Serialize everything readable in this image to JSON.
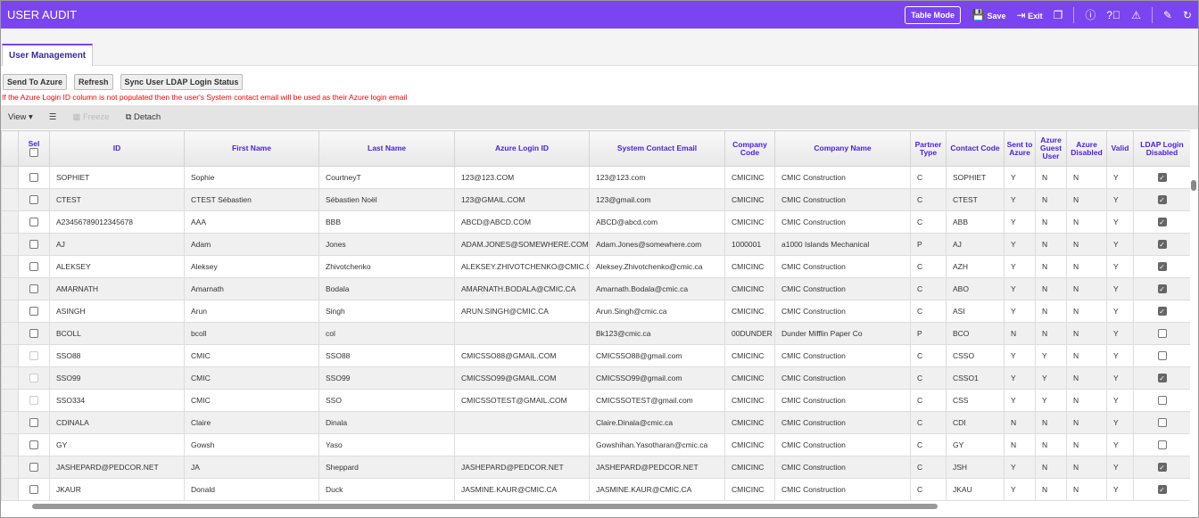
{
  "header": {
    "title": "USER AUDIT",
    "table_mode": "Table Mode",
    "save": "Save",
    "exit": "Exit",
    "icons": [
      "save-icon",
      "exit-icon",
      "windows-icon",
      "info-icon",
      "help-icon",
      "warning-icon",
      "edit-icon",
      "refresh-icon"
    ]
  },
  "tabs": [
    {
      "label": "User Management",
      "active": true
    }
  ],
  "buttons": {
    "send": "Send To Azure",
    "refresh": "Refresh",
    "sync": "Sync User LDAP Login Status"
  },
  "note": "If the Azure Login ID column is not populated then the user's System contact email will be used as their Azure login email",
  "toolbar": {
    "view": "View ▾",
    "freeze": "Freeze",
    "detach": "Detach"
  },
  "colors": {
    "accent": "#7a45f0",
    "header_text": "#4d1fd6",
    "note": "#ff0000"
  },
  "columns": [
    "Sel",
    "ID",
    "First Name",
    "Last Name",
    "Azure Login ID",
    "System Contact Email",
    "Company Code",
    "Company Name",
    "Partner Type",
    "Contact Code",
    "Sent to Azure",
    "Azure Guest User",
    "Azure Disabled",
    "Valid",
    "LDAP Login Disabled"
  ],
  "rows": [
    {
      "id": "SOPHIET",
      "first": "Sophie",
      "last": "CourtneyT",
      "azure": "123@123.COM",
      "email": "123@123.com",
      "code": "CMICINC",
      "company": "CMIC Construction",
      "ptype": "C",
      "contact": "SOPHIET",
      "sent": "Y",
      "guest": "N",
      "disabled": "N",
      "valid": "Y",
      "ldap": true,
      "sel_enabled": true
    },
    {
      "id": "CTEST",
      "first": "CTEST Sébastien",
      "last": "Sébastien Noël",
      "azure": "123@GMAIL.COM",
      "email": "123@gmail.com",
      "code": "CMICINC",
      "company": "CMIC Construction",
      "ptype": "C",
      "contact": "CTEST",
      "sent": "Y",
      "guest": "N",
      "disabled": "N",
      "valid": "Y",
      "ldap": true,
      "sel_enabled": true
    },
    {
      "id": "A23456789012345678",
      "first": "AAA",
      "last": "BBB",
      "azure": "ABCD@ABCD.COM",
      "email": "ABCD@abcd.com",
      "code": "CMICINC",
      "company": "CMIC Construction",
      "ptype": "C",
      "contact": "ABB",
      "sent": "Y",
      "guest": "N",
      "disabled": "N",
      "valid": "Y",
      "ldap": true,
      "sel_enabled": true
    },
    {
      "id": "AJ",
      "first": "Adam",
      "last": "Jones",
      "azure": "ADAM.JONES@SOMEWHERE.COM",
      "email": "Adam.Jones@somewhere.com",
      "code": "1000001",
      "company": "a1000 Islands Mechanical",
      "ptype": "P",
      "contact": "AJ",
      "sent": "Y",
      "guest": "N",
      "disabled": "N",
      "valid": "Y",
      "ldap": true,
      "sel_enabled": true
    },
    {
      "id": "ALEKSEY",
      "first": "Aleksey",
      "last": "Zhivotchenko",
      "azure": "ALEKSEY.ZHIVOTCHENKO@CMIC.CA",
      "email": "Aleksey.Zhivotchenko@cmic.ca",
      "code": "CMICINC",
      "company": "CMIC Construction",
      "ptype": "C",
      "contact": "AZH",
      "sent": "Y",
      "guest": "N",
      "disabled": "N",
      "valid": "Y",
      "ldap": true,
      "sel_enabled": true
    },
    {
      "id": "AMARNATH",
      "first": "Amarnath",
      "last": "Bodala",
      "azure": "AMARNATH.BODALA@CMIC.CA",
      "email": "Amarnath.Bodala@cmic.ca",
      "code": "CMICINC",
      "company": "CMIC Construction",
      "ptype": "C",
      "contact": "ABO",
      "sent": "Y",
      "guest": "N",
      "disabled": "N",
      "valid": "Y",
      "ldap": true,
      "sel_enabled": true
    },
    {
      "id": "ASINGH",
      "first": "Arun",
      "last": "Singh",
      "azure": "ARUN.SINGH@CMIC.CA",
      "email": "Arun.Singh@cmic.ca",
      "code": "CMICINC",
      "company": "CMIC Construction",
      "ptype": "C",
      "contact": "ASI",
      "sent": "Y",
      "guest": "N",
      "disabled": "N",
      "valid": "Y",
      "ldap": true,
      "sel_enabled": true
    },
    {
      "id": "BCOLL",
      "first": "bcoll",
      "last": "col",
      "azure": "",
      "email": "Bk123@cmic.ca",
      "code": "00DUNDER",
      "company": "Dunder Mifflin Paper Co",
      "ptype": "P",
      "contact": "BCO",
      "sent": "N",
      "guest": "N",
      "disabled": "N",
      "valid": "Y",
      "ldap": false,
      "sel_enabled": true
    },
    {
      "id": "SSO88",
      "first": "CMIC",
      "last": "SSO88",
      "azure": "CMICSSO88@GMAIL.COM",
      "email": "CMICSSO88@gmail.com",
      "code": "CMICINC",
      "company": "CMIC Construction",
      "ptype": "C",
      "contact": "CSSO",
      "sent": "Y",
      "guest": "Y",
      "disabled": "N",
      "valid": "Y",
      "ldap": false,
      "sel_enabled": false
    },
    {
      "id": "SSO99",
      "first": "CMIC",
      "last": "SSO99",
      "azure": "CMICSSO99@GMAIL.COM",
      "email": "CMICSSO99@gmail.com",
      "code": "CMICINC",
      "company": "CMIC Construction",
      "ptype": "C",
      "contact": "CSSO1",
      "sent": "Y",
      "guest": "Y",
      "disabled": "N",
      "valid": "Y",
      "ldap": true,
      "sel_enabled": false
    },
    {
      "id": "SSO334",
      "first": "CMIC",
      "last": "SSO",
      "azure": "CMICSSOTEST@GMAIL.COM",
      "email": "CMICSSOTEST@gmail.com",
      "code": "CMICINC",
      "company": "CMIC Construction",
      "ptype": "C",
      "contact": "CSS",
      "sent": "Y",
      "guest": "Y",
      "disabled": "N",
      "valid": "Y",
      "ldap": false,
      "sel_enabled": false
    },
    {
      "id": "CDINALA",
      "first": "Claire",
      "last": "Dinala",
      "azure": "",
      "email": "Claire.Dinala@cmic.ca",
      "code": "CMICINC",
      "company": "CMIC Construction",
      "ptype": "C",
      "contact": "CDI",
      "sent": "N",
      "guest": "N",
      "disabled": "N",
      "valid": "Y",
      "ldap": false,
      "sel_enabled": true
    },
    {
      "id": "GY",
      "first": "Gowsh",
      "last": "Yaso",
      "azure": "",
      "email": "Gowshihan.Yasotharan@cmic.ca",
      "code": "CMICINC",
      "company": "CMIC Construction",
      "ptype": "C",
      "contact": "GY",
      "sent": "N",
      "guest": "N",
      "disabled": "N",
      "valid": "Y",
      "ldap": false,
      "sel_enabled": true
    },
    {
      "id": "JASHEPARD@PEDCOR.NET",
      "first": "JA",
      "last": "Sheppard",
      "azure": "JASHEPARD@PEDCOR.NET",
      "email": "JASHEPARD@PEDCOR.NET",
      "code": "CMICINC",
      "company": "CMIC Construction",
      "ptype": "C",
      "contact": "JSH",
      "sent": "Y",
      "guest": "N",
      "disabled": "N",
      "valid": "Y",
      "ldap": true,
      "sel_enabled": true
    },
    {
      "id": "JKAUR",
      "first": "Donald",
      "last": "Duck",
      "azure": "JASMINE.KAUR@CMIC.CA",
      "email": "JASMINE.KAUR@CMIC.CA",
      "code": "CMICINC",
      "company": "CMIC Construction",
      "ptype": "C",
      "contact": "JKAU",
      "sent": "Y",
      "guest": "N",
      "disabled": "N",
      "valid": "Y",
      "ldap": true,
      "sel_enabled": true
    }
  ]
}
